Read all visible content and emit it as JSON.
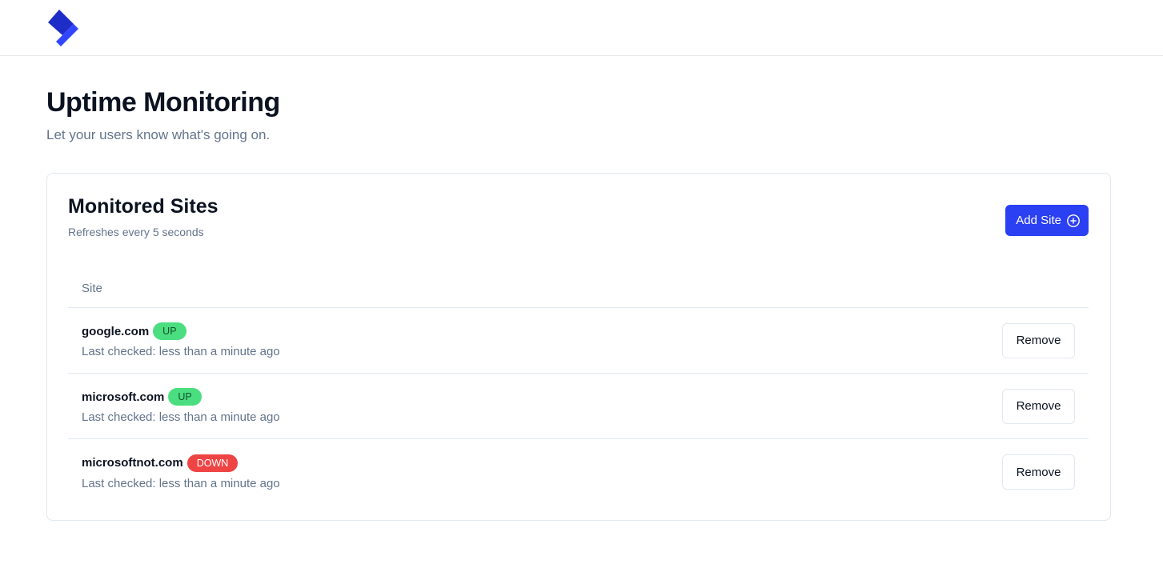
{
  "colors": {
    "accent": "#2b3ff3",
    "logo_dark": "#1e2cc8",
    "logo_light": "#3346ff",
    "badge_up": "#4ade80",
    "badge_down": "#ef4444"
  },
  "header": {
    "logo_icon": "app-logo-icon"
  },
  "page": {
    "title": "Uptime Monitoring",
    "subtitle": "Let your users know what's going on."
  },
  "card": {
    "title": "Monitored Sites",
    "subtitle": "Refreshes every 5 seconds",
    "add_button_label": "Add Site",
    "add_button_icon": "plus-circle-icon"
  },
  "table": {
    "columns": [
      "Site"
    ],
    "rows": [
      {
        "site": "google.com",
        "status": "UP",
        "last_checked": "Last checked: less than a minute ago",
        "action": "Remove"
      },
      {
        "site": "microsoft.com",
        "status": "UP",
        "last_checked": "Last checked: less than a minute ago",
        "action": "Remove"
      },
      {
        "site": "microsoftnot.com",
        "status": "DOWN",
        "last_checked": "Last checked: less than a minute ago",
        "action": "Remove"
      }
    ]
  }
}
